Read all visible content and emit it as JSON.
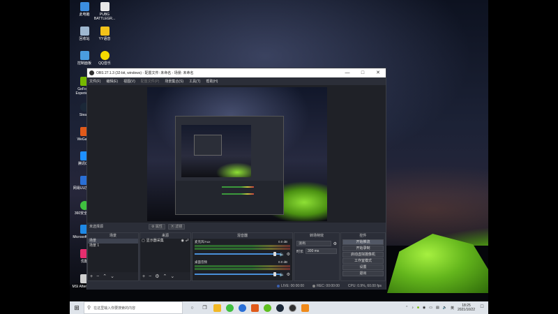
{
  "desktop": {
    "icons": [
      {
        "label": "此电脑",
        "color": "#3b8de0"
      },
      {
        "label": "PUBG BATTLEGR...",
        "color": "#e8e8e8"
      },
      {
        "label": "回收站",
        "color": "#9fb8d0"
      },
      {
        "label": "YY语音",
        "color": "#f2c21a"
      },
      {
        "label": "控制面板",
        "color": "#4a9de0"
      },
      {
        "label": "QQ音乐",
        "color": "#f5d900"
      },
      {
        "label": "GeForce Experience",
        "color": "#76b900"
      },
      {
        "label": "Steam",
        "color": "#1b2838"
      },
      {
        "label": "WeGame",
        "color": "#e05a1a"
      },
      {
        "label": "腾讯QQ",
        "color": "#1e90ff"
      },
      {
        "label": "网易UU加速器",
        "color": "#2a6fd6"
      },
      {
        "label": "360安全卫士",
        "color": "#3fbf3f"
      },
      {
        "label": "Microsoft Edge",
        "color": "#1e88e5"
      },
      {
        "label": "优酷",
        "color": "#e62e6e"
      },
      {
        "label": "MSI Afterburner",
        "color": "#cfcfcf"
      }
    ]
  },
  "obs": {
    "title": "OBS 27.1.3 (32-bit, windows) - 配置文件: 未命名 - 场景: 未命名",
    "menu": [
      "文件(F)",
      "编辑(E)",
      "视图(V)",
      "配置文件(P)",
      "场景集合(S)",
      "工具(T)",
      "帮助(H)"
    ],
    "source_status": "未选择源",
    "properties_label": "属性",
    "filters_label": "滤镜",
    "docks": {
      "scenes": {
        "title": "场景",
        "items": [
          "场景",
          "场景 1"
        ]
      },
      "sources": {
        "title": "来源",
        "items": [
          "显示器采集"
        ]
      },
      "mixer": {
        "title": "混音器",
        "channels": [
          {
            "name": "麦克风/Aux",
            "db": "0.0 dB",
            "level": 0.0
          },
          {
            "name": "桌面音频",
            "db": "0.0 dB",
            "level": 0.0
          }
        ]
      },
      "transitions": {
        "title": "转场特效",
        "type": "淡出",
        "duration_label": "时长",
        "duration_value": "300 ms"
      },
      "controls": {
        "title": "控件",
        "buttons": [
          "开始推流",
          "开始录制",
          "启动虚拟摄像机",
          "工作室模式",
          "设置",
          "退出"
        ]
      }
    },
    "status": {
      "live": "LIVE: 00:00:00",
      "rec": "REC: 00:00:00",
      "cpu": "CPU: 0.9%, 60.00 fps"
    }
  },
  "taskbar": {
    "search_placeholder": "在这里输入你要搜索的内容",
    "time": "18:25",
    "date": "2021/10/22",
    "ime": "英",
    "apps": [
      {
        "name": "task-view",
        "color": "#444"
      },
      {
        "name": "file-explorer",
        "color": "#f2b824"
      },
      {
        "name": "qq-music",
        "color": "#3fbf3f"
      },
      {
        "name": "browser-blue",
        "color": "#2a6fd6"
      },
      {
        "name": "wegame",
        "color": "#e05a1a"
      },
      {
        "name": "qq-music-2",
        "color": "#5fbf1f"
      },
      {
        "name": "steam",
        "color": "#1b2838"
      },
      {
        "name": "obs",
        "color": "#303030"
      },
      {
        "name": "app-orange",
        "color": "#f08a1a"
      }
    ]
  }
}
